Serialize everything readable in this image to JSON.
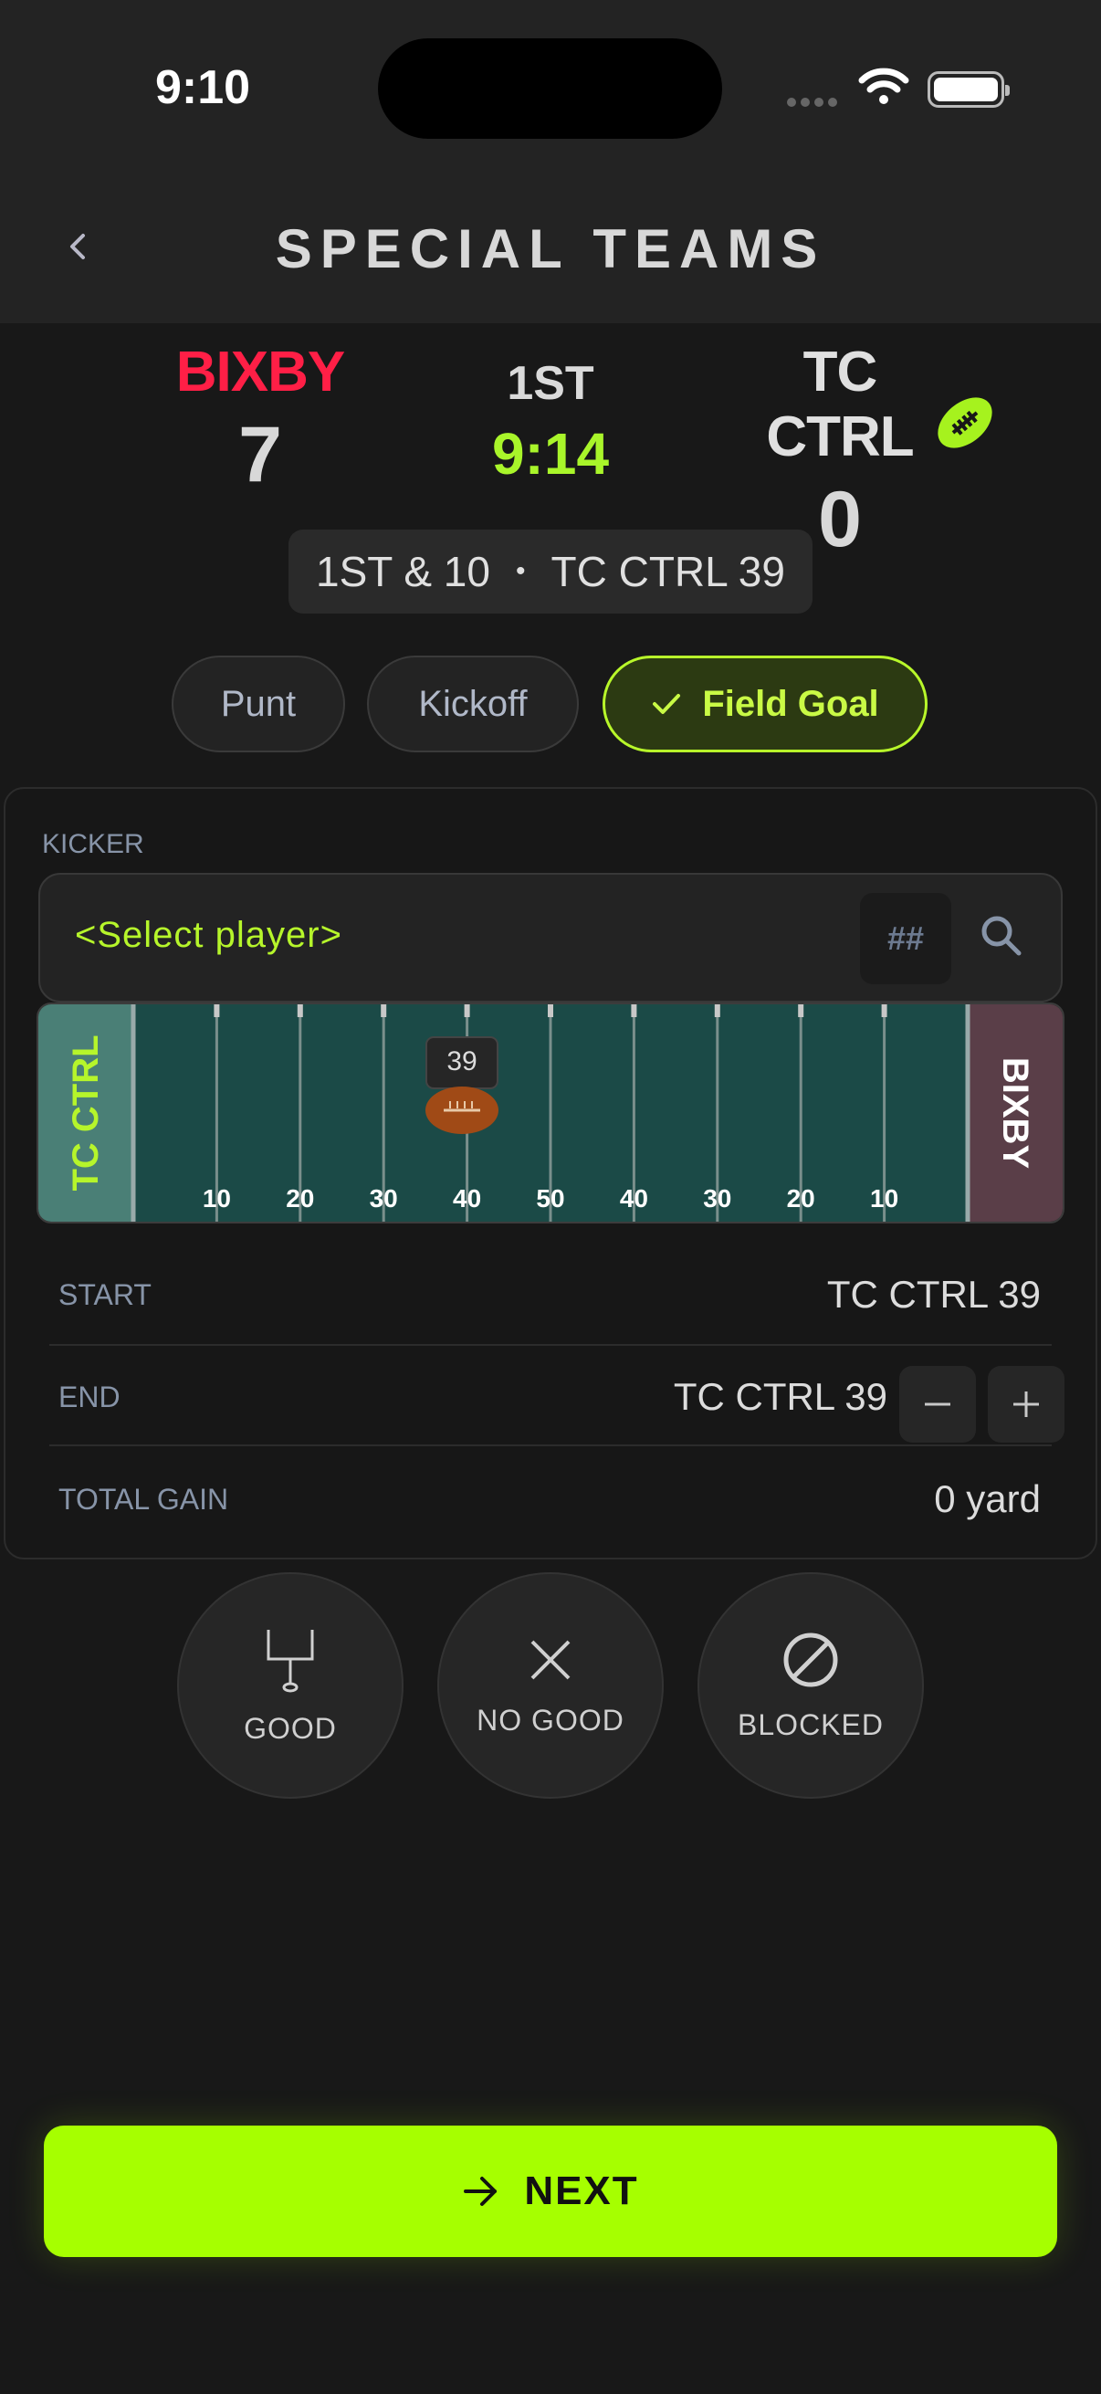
{
  "status_bar": {
    "time": "9:10"
  },
  "header": {
    "title": "SPECIAL TEAMS",
    "back_icon": "chevron-left-icon"
  },
  "scoreboard": {
    "home": {
      "name": "BIXBY",
      "score": "7",
      "color": "#ff1f46"
    },
    "away": {
      "name": "TC CTRL",
      "score": "0",
      "possession_icon": "football-icon"
    },
    "period": "1ST",
    "clock": "9:14",
    "clock_color": "#a9f52a"
  },
  "situation": {
    "down": "1ST & 10",
    "separator": "•",
    "spot": "TC CTRL 39"
  },
  "play_types": {
    "punt": "Punt",
    "kickoff": "Kickoff",
    "field_goal": "Field Goal",
    "selected": "Field Goal"
  },
  "kicker": {
    "label": "KICKER",
    "placeholder": "<Select player>",
    "jersey_button": "##"
  },
  "field": {
    "left_endzone": "TC CTRL",
    "right_endzone": "BIXBY",
    "yard_labels": [
      "10",
      "20",
      "30",
      "40",
      "50",
      "40",
      "30",
      "20",
      "10"
    ],
    "ball_marker": "39"
  },
  "rows": {
    "start_label": "START",
    "start_value": "TC CTRL 39",
    "end_label": "END",
    "end_value": "TC CTRL 39",
    "gain_label": "TOTAL GAIN",
    "gain_value": "0 yard"
  },
  "results": {
    "good": "GOOD",
    "no_good": "NO GOOD",
    "blocked": "BLOCKED"
  },
  "next": {
    "label": "NEXT"
  },
  "colors": {
    "accent": "#a6ff00",
    "field": "#1b4a47",
    "left_endzone": "#4a7f76",
    "right_endzone": "#5a3e48"
  }
}
